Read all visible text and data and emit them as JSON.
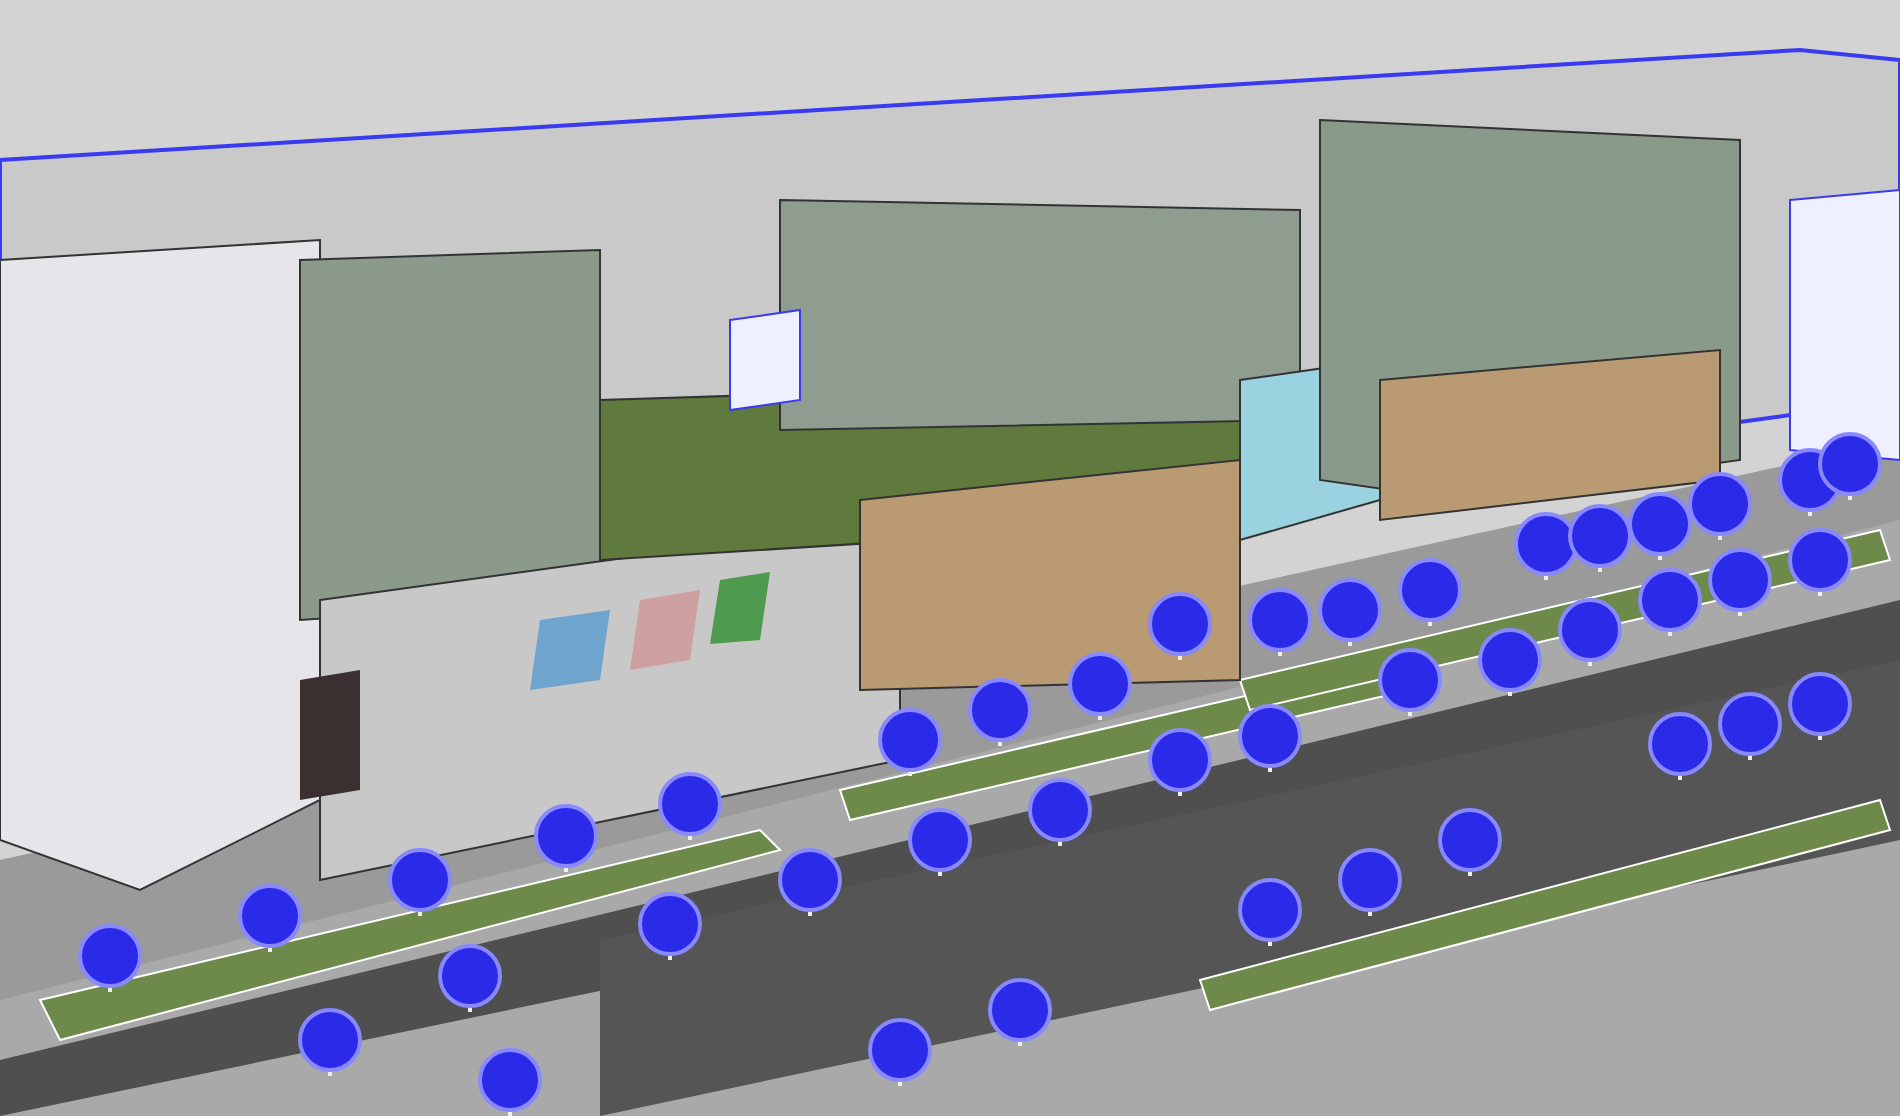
{
  "scene": {
    "kind": "street-render"
  }
}
